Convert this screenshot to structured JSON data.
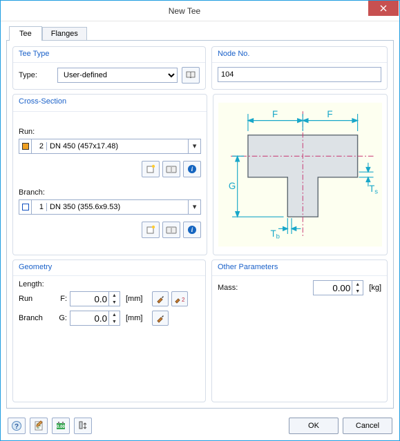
{
  "window": {
    "title": "New Tee"
  },
  "tabs": {
    "tee": "Tee",
    "flanges": "Flanges"
  },
  "teeType": {
    "title": "Tee Type",
    "type_label": "Type:",
    "type_value": "User-defined"
  },
  "nodeNo": {
    "title": "Node No.",
    "value": "104"
  },
  "crossSection": {
    "title": "Cross-Section",
    "run_label": "Run:",
    "branch_label": "Branch:",
    "run": {
      "swatch": "#f0a020",
      "num": "2",
      "text": "DN 450 (457x17.48)"
    },
    "branch": {
      "swatch": "#ffffff",
      "num": "1",
      "text": "DN 350 (355.6x9.53)"
    }
  },
  "geometry": {
    "title": "Geometry",
    "length_label": "Length:",
    "row1": {
      "name": "Run",
      "sym": "F:",
      "value": "0.0",
      "unit": "[mm]"
    },
    "row2": {
      "name": "Branch",
      "sym": "G:",
      "value": "0.0",
      "unit": "[mm]"
    }
  },
  "other": {
    "title": "Other Parameters",
    "mass_label": "Mass:",
    "mass_value": "0.00",
    "mass_unit": "[kg]"
  },
  "diagram": {
    "F": "F",
    "G": "G",
    "Tb": "T",
    "Tb_sub": "b",
    "Ts": "T",
    "Ts_sub": "s"
  },
  "buttons": {
    "ok": "OK",
    "cancel": "Cancel"
  }
}
